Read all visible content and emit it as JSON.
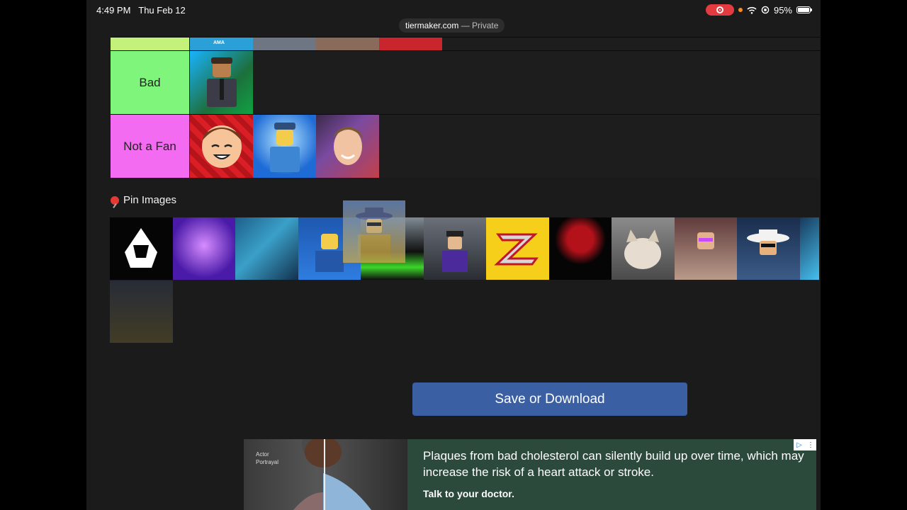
{
  "status_bar": {
    "time": "4:49 PM",
    "date": "Thu Feb 12",
    "battery": "95%"
  },
  "browser": {
    "domain": "tiermaker.com",
    "mode": "— Private"
  },
  "tiers": [
    {
      "label": "",
      "color": "#c3f17a"
    },
    {
      "label": "Bad",
      "color": "#7ff57b"
    },
    {
      "label": "Not a Fan",
      "color": "#f26bf0"
    }
  ],
  "pin_section": {
    "title": "Pin Images"
  },
  "save_button": {
    "label": "Save or Download"
  },
  "ad": {
    "caption": "Actor Portrayal",
    "headline": "Plaques from bad cholesterol can silently build up over time, which may increase the risk of a heart attack or stroke.",
    "subline": "Talk to your doctor."
  },
  "thumbnail_top_text": "AMA"
}
